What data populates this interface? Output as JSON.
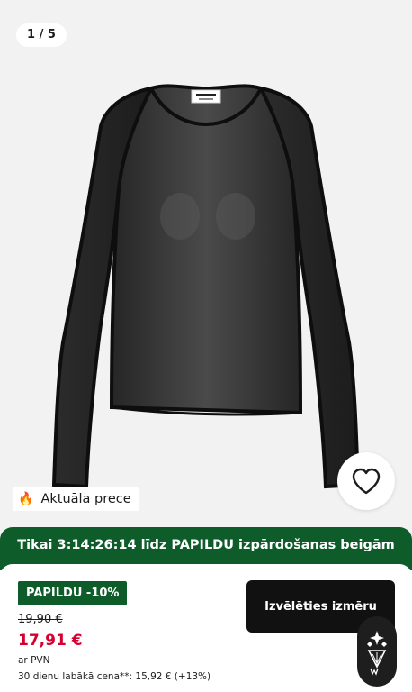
{
  "gallery": {
    "counter": "1 / 5",
    "image_alt": "Melns caurspīdīgs garpiedurkņu tops"
  },
  "badges": {
    "hot_label": "Aktuāla prece",
    "hot_icon": "fire-icon"
  },
  "favorite": {
    "icon": "heart-icon"
  },
  "promo": {
    "text": "Tikai 3:14:26:14 līdz PAPILDU izpārdošanas beigām",
    "color": "#0f5c2b"
  },
  "price": {
    "discount_label": "PAPILDU -10%",
    "old": "19,90 €",
    "current": "17,91 €",
    "vat": "ar PVN",
    "lowest_30d": "30 dienu labākā cena**: 15,92 € (+13%)",
    "current_color": "#d6002e"
  },
  "actions": {
    "select_size": "Izvēlēties izmēru"
  },
  "assistant": {
    "icon": "assistant-logo-icon"
  }
}
